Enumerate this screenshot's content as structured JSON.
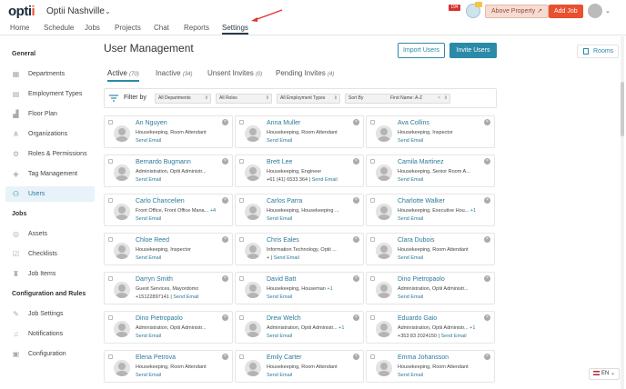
{
  "header": {
    "logo_main": "opti",
    "logo_accent": "i",
    "org_name": "Optii Nashville",
    "notification_count": "194",
    "property_button": "Above Property",
    "add_job_button": "Add Job"
  },
  "nav": {
    "items": [
      "Home",
      "Schedule",
      "Jobs",
      "Projects",
      "Chat",
      "Reports",
      "Settings"
    ],
    "active": "Settings"
  },
  "sidebar": {
    "sections": [
      {
        "title": "General",
        "items": [
          "Departments",
          "Employment Types",
          "Floor Plan",
          "Organizations",
          "Roles & Permissions",
          "Tag Management",
          "Users"
        ]
      },
      {
        "title": "Jobs",
        "items": [
          "Assets",
          "Checklists",
          "Job Items"
        ]
      },
      {
        "title": "Configuration and Rules",
        "items": [
          "Job Settings",
          "Notifications",
          "Configuration"
        ]
      }
    ],
    "active": "Users"
  },
  "page": {
    "title": "User Management",
    "import_button": "Import Users",
    "invite_button": "Invite Users",
    "rooms_button": "Rooms"
  },
  "tabs": [
    {
      "label": "Active",
      "count": "(70)"
    },
    {
      "label": "Inactive",
      "count": "(34)"
    },
    {
      "label": "Unsent Invites",
      "count": "(0)"
    },
    {
      "label": "Pending Invites",
      "count": "(4)"
    }
  ],
  "filters": {
    "label": "Filter by",
    "departments": "All Departments",
    "roles": "All Roles",
    "employment_types": "All Employment Types",
    "sort_by_label": "Sort By",
    "sort_by_value": "First Name: A-Z"
  },
  "users": [
    {
      "name": "An Nguyen",
      "role": "Housekeeping, Room Attendant",
      "extra": "",
      "phone": "",
      "action": "Send Email"
    },
    {
      "name": "Anna Muller",
      "role": "Housekeeping, Room Attendant",
      "extra": "",
      "phone": "",
      "action": "Send Email"
    },
    {
      "name": "Ava Collins",
      "role": "Housekeeping, Inspector",
      "extra": "",
      "phone": "",
      "action": "Send Email"
    },
    {
      "name": "Bernardo Bugmann",
      "role": "Administration, Optii Administr...",
      "extra": "",
      "phone": "",
      "action": "Send Email"
    },
    {
      "name": "Brett Lee",
      "role": "Housekeeping, Engineer",
      "extra": "",
      "phone": "+61 (41) 6533 364 |",
      "action": "Send Email"
    },
    {
      "name": "Camila Martinez",
      "role": "Housekeeping, Senior Room A...",
      "extra": "",
      "phone": "",
      "action": "Send Email"
    },
    {
      "name": "Carlo Chancelien",
      "role": "Front Office, Front Office Mana...",
      "extra": "+4",
      "phone": "",
      "action": "Send Email"
    },
    {
      "name": "Carlos Parra",
      "role": "Housekeeping, Housekeeping ...",
      "extra": "",
      "phone": "",
      "action": "Send Email"
    },
    {
      "name": "Charlotte Walker",
      "role": "Housekeeping, Executive Hou...",
      "extra": "+1",
      "phone": "",
      "action": "Send Email"
    },
    {
      "name": "Chloe  Reed",
      "role": "Housekeeping, Inspector",
      "extra": "",
      "phone": "",
      "action": "Send Email"
    },
    {
      "name": "Chris Eales",
      "role": "Information Technology, Optii ...",
      "extra": "",
      "phone": "+ |",
      "action": "Send Email"
    },
    {
      "name": "Clara Dubois",
      "role": "Housekeeping, Room Attendant",
      "extra": "",
      "phone": "",
      "action": "Send Email"
    },
    {
      "name": "Darryn Smith",
      "role": "Guest Services, Mayordomo",
      "extra": "",
      "phone": "+15122897141 |",
      "action": "Send Email"
    },
    {
      "name": "David Batt",
      "role": "Housekeeping, Houseman",
      "extra": "+1",
      "phone": "",
      "action": "Send Email"
    },
    {
      "name": "Dino Pietropaolo",
      "role": "Administration, Optii Administr...",
      "extra": "",
      "phone": "",
      "action": "Send Email"
    },
    {
      "name": "Dino Pietropaolo",
      "role": "Administration, Optii Administr...",
      "extra": "",
      "phone": "",
      "action": "Send Email"
    },
    {
      "name": "Drew Welch",
      "role": "Administration, Optii Administr...",
      "extra": "+1",
      "phone": "",
      "action": "Send Email"
    },
    {
      "name": "Eduardo Gaio",
      "role": "Administration, Optii Administr...",
      "extra": "+1",
      "phone": "+353 83 2024150 |",
      "action": "Send Email"
    },
    {
      "name": "Elena Petrova",
      "role": "Housekeeping, Room Attendant",
      "extra": "",
      "phone": "",
      "action": "Send Email"
    },
    {
      "name": "Emily Carter",
      "role": "Housekeeping, Room Attendant",
      "extra": "",
      "phone": "",
      "action": "Send Email"
    },
    {
      "name": "Emma Johansson",
      "role": "Housekeeping, Room Attendant",
      "extra": "",
      "phone": "",
      "action": "Send Email"
    }
  ],
  "language": "EN",
  "colors": {
    "accent": "#2b8aa8",
    "brand": "#e8502f",
    "link": "#2b7a9a"
  }
}
